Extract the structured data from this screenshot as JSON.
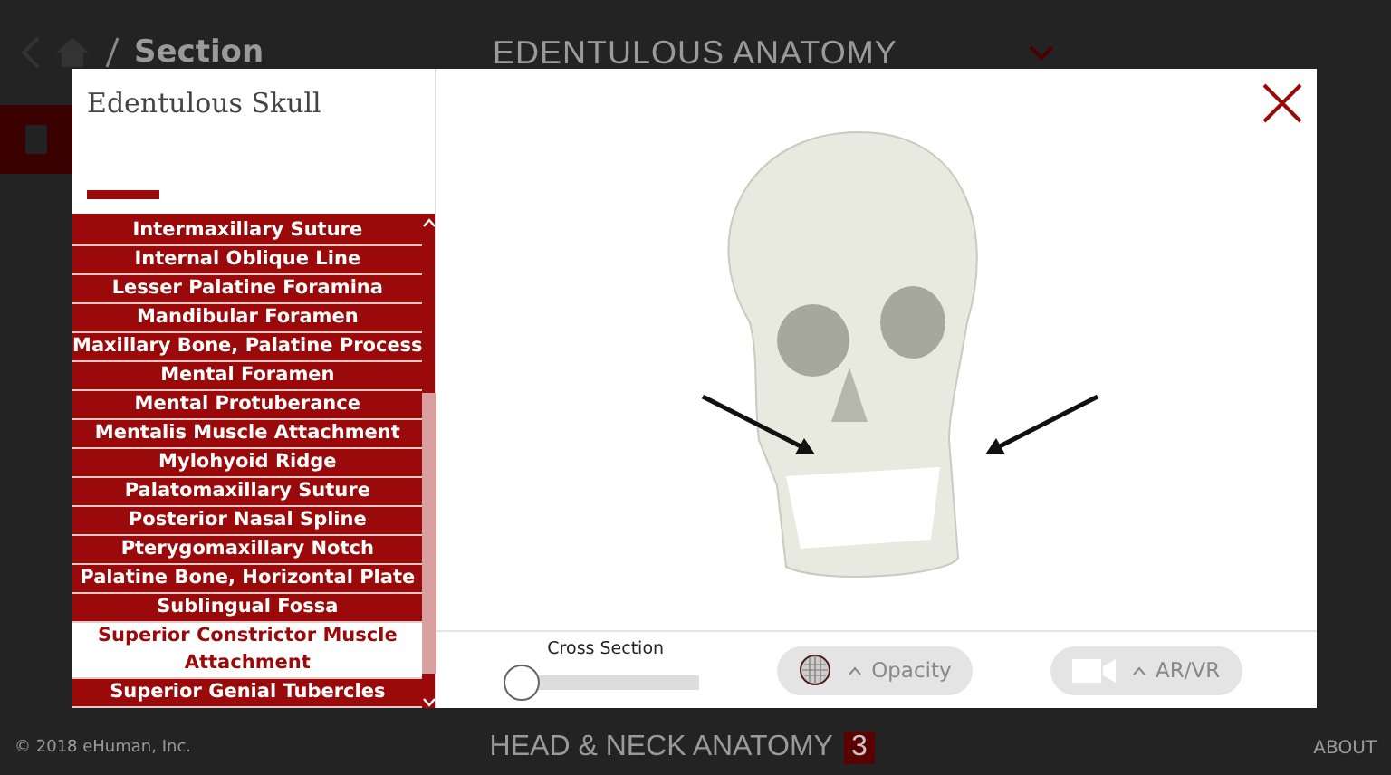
{
  "header": {
    "breadcrumb": "Section",
    "title": "EDENTULOUS ANATOMY"
  },
  "modal": {
    "title": "Edentulous Skull",
    "items": [
      {
        "label": "Intermaxillary Suture",
        "selected": false
      },
      {
        "label": "Internal Oblique Line",
        "selected": false
      },
      {
        "label": "Lesser Palatine Foramina",
        "selected": false
      },
      {
        "label": "Mandibular Foramen",
        "selected": false
      },
      {
        "label": "Maxillary Bone, Palatine Process",
        "selected": false
      },
      {
        "label": "Mental Foramen",
        "selected": false
      },
      {
        "label": "Mental Protuberance",
        "selected": false
      },
      {
        "label": "Mentalis Muscle Attachment",
        "selected": false
      },
      {
        "label": "Mylohyoid Ridge",
        "selected": false
      },
      {
        "label": "Palatomaxillary Suture",
        "selected": false
      },
      {
        "label": "Posterior Nasal Spline",
        "selected": false
      },
      {
        "label": "Pterygomaxillary Notch",
        "selected": false
      },
      {
        "label": "Palatine Bone, Horizontal Plate",
        "selected": false
      },
      {
        "label": "Sublingual Fossa",
        "selected": false
      },
      {
        "label": "Superior Constrictor Muscle Attachment",
        "selected": true
      },
      {
        "label": "Superior Genial Tubercles",
        "selected": false
      }
    ],
    "cross_section": {
      "label": "Cross Section",
      "level": 0
    },
    "opacity": {
      "label": "Opacity"
    },
    "ar_vr": {
      "label": "AR/VR"
    }
  },
  "footer": {
    "copyright": "© 2018 eHuman, Inc.",
    "title": "HEAD & NECK ANATOMY",
    "volume": "3",
    "about": "ABOUT"
  }
}
